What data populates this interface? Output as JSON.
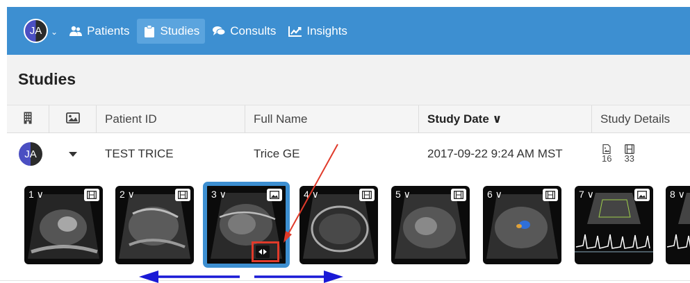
{
  "nav": {
    "user_initials": "JA",
    "items": [
      {
        "label": "Patients",
        "icon": "users-icon",
        "active": false
      },
      {
        "label": "Studies",
        "icon": "clipboard-icon",
        "active": true
      },
      {
        "label": "Consults",
        "icon": "chat-icon",
        "active": false
      },
      {
        "label": "Insights",
        "icon": "line-chart-icon",
        "active": false
      }
    ]
  },
  "page": {
    "title": "Studies"
  },
  "table": {
    "columns": [
      {
        "label": "",
        "icon": "building-icon"
      },
      {
        "label": "",
        "icon": "image-icon"
      },
      {
        "label": "Patient ID"
      },
      {
        "label": "Full Name"
      },
      {
        "label": "Study Date ∨",
        "sorted": true
      },
      {
        "label": "Study Details"
      }
    ],
    "row": {
      "initials": "JA",
      "patient_id": "TEST TRICE",
      "full_name": "Trice GE",
      "study_date": "2017-09-22 9:24 AM MST",
      "image_count": "16",
      "clip_count": "33"
    }
  },
  "thumbnails": [
    {
      "label": "1 ∨",
      "type": "clip-icon",
      "selected": false
    },
    {
      "label": "2 ∨",
      "type": "clip-icon",
      "selected": false
    },
    {
      "label": "3 ∨",
      "type": "image-icon",
      "selected": true
    },
    {
      "label": "4 ∨",
      "type": "clip-icon",
      "selected": false
    },
    {
      "label": "5 ∨",
      "type": "clip-icon",
      "selected": false
    },
    {
      "label": "6 ∨",
      "type": "clip-icon",
      "selected": false
    },
    {
      "label": "7 ∨",
      "type": "image-icon",
      "selected": false
    },
    {
      "label": "8 ∨",
      "type": "image-icon",
      "selected": false
    }
  ],
  "annotation_colors": {
    "highlight": "#e03a2a",
    "scroll_arrows": "#1a1ad6"
  }
}
